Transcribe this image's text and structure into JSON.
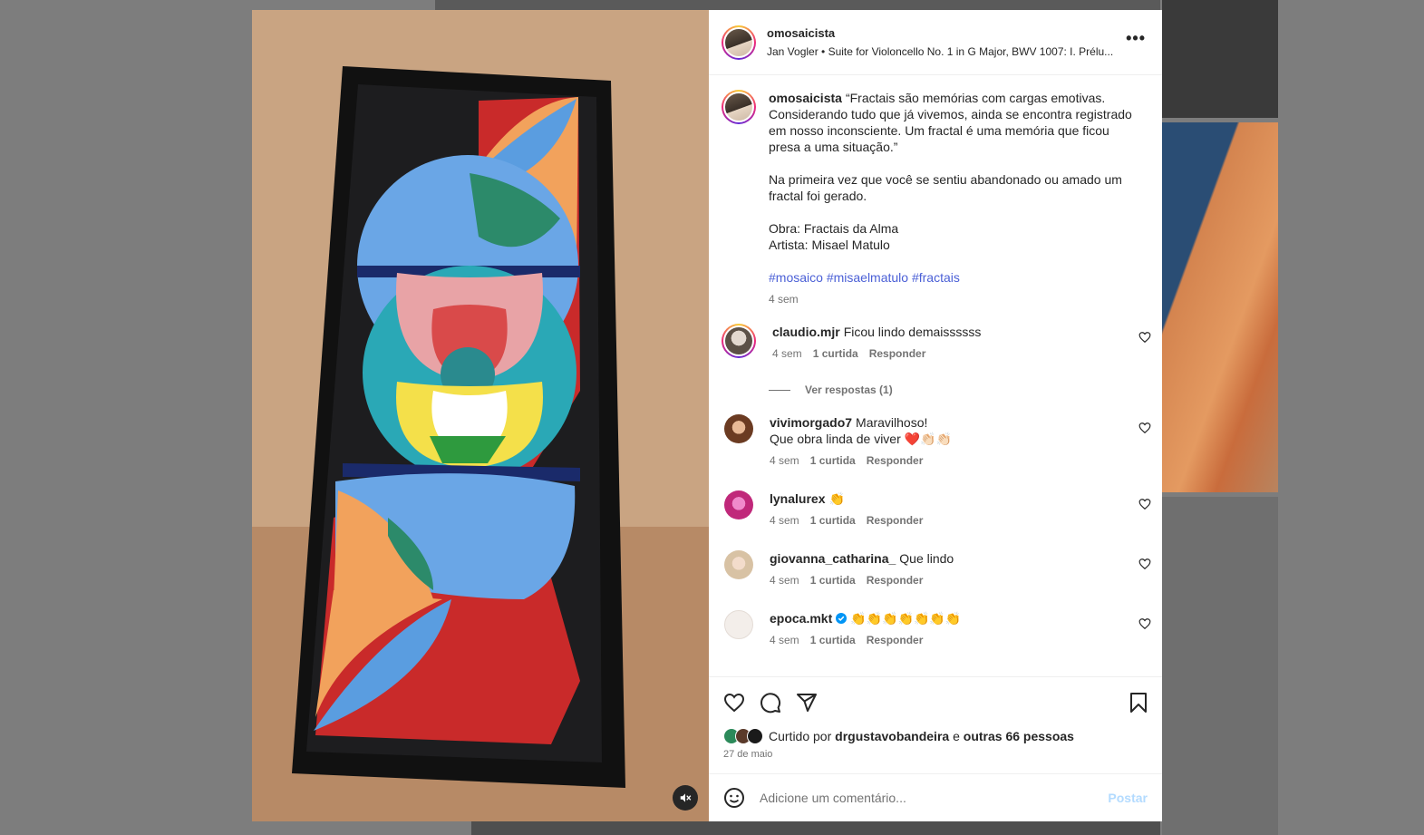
{
  "post": {
    "username": "omosaicista",
    "audio": "Jan Vogler • Suite for Violoncello No. 1 in G Major, BWV 1007: I. Prélu...",
    "more_label": "•••",
    "caption_username": "omosaicista",
    "caption_p1": "“Fractais são memórias com cargas emotivas. Considerando tudo que já vivemos, ainda se encontra registrado em nosso inconsciente. Um fractal é uma memória que ficou presa a uma situação.”",
    "caption_p2": "Na primeira vez que você se sentiu abandonado ou amado um fractal foi gerado.",
    "caption_p3a": "Obra: Fractais da Alma",
    "caption_p3b": "Artista: Misael Matulo",
    "hashtags": [
      "#mosaico",
      "#misaelmatulo",
      "#fractais"
    ],
    "caption_time": "4 sem"
  },
  "comments": [
    {
      "user": "claudio.mjr",
      "text": "Ficou lindo demaissssss",
      "time": "4 sem",
      "likes": "1 curtida",
      "reply": "Responder",
      "view_replies": "Ver respostas (1)"
    },
    {
      "user": "vivimorgado7",
      "text": "Maravilhoso!",
      "text2": "Que obra linda de viver ❤️👏🏻👏🏻",
      "time": "4 sem",
      "likes": "1 curtida",
      "reply": "Responder"
    },
    {
      "user": "lynalurex",
      "text": "👏",
      "time": "4 sem",
      "likes": "1 curtida",
      "reply": "Responder"
    },
    {
      "user": "giovanna_catharina_",
      "text": "Que lindo",
      "time": "4 sem",
      "likes": "1 curtida",
      "reply": "Responder"
    },
    {
      "user": "epoca.mkt",
      "text": "👏👏👏👏👏👏👏",
      "time": "4 sem",
      "likes": "1 curtida",
      "reply": "Responder"
    }
  ],
  "likes": {
    "prefix": "Curtido por",
    "user": "drgustavobandeira",
    "mid": "e",
    "others": "outras 66 pessoas"
  },
  "date": "27 de maio",
  "add_comment": {
    "placeholder": "Adicione um comentário...",
    "post_label": "Postar"
  },
  "colors": {
    "link": "#4a5fd6",
    "verified": "#0095f6",
    "heart_red": "#ed1c24"
  },
  "icons": [
    "heart-icon",
    "comment-icon",
    "share-icon",
    "bookmark-icon",
    "emoji-icon",
    "mute-icon",
    "verified-icon",
    "more-icon"
  ]
}
